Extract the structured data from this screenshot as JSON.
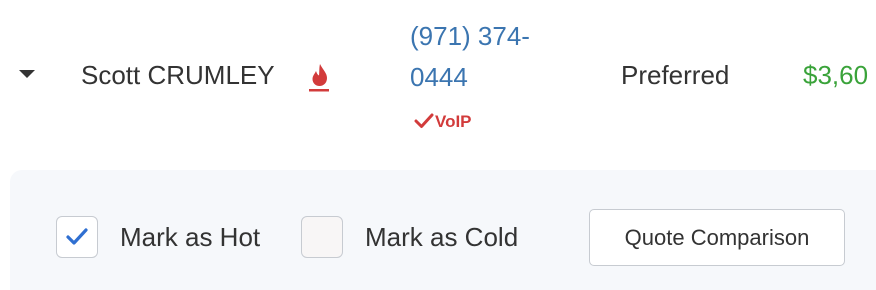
{
  "lead": {
    "name": "Scott CRUMLEY",
    "phone": "(971) 374-0444",
    "phone_type": "VoIP",
    "status": "Preferred",
    "premium": "$3,60"
  },
  "actions": {
    "mark_hot": {
      "label": "Mark as Hot",
      "checked": true
    },
    "mark_cold": {
      "label": "Mark as Cold",
      "checked": false
    },
    "quote_button": "Quote Comparison"
  },
  "icons": {
    "expand": "caret-down-icon",
    "hot_lead": "flame-icon",
    "voip_check": "checkmark-icon",
    "checkbox_check": "checkmark-icon"
  },
  "colors": {
    "phone_link": "#3b75b0",
    "voip": "#d23b3b",
    "flame": "#d23b3b",
    "premium": "#3aa33a",
    "checkbox_check": "#2f6fd1",
    "panel_bg": "#f6f8fb"
  }
}
